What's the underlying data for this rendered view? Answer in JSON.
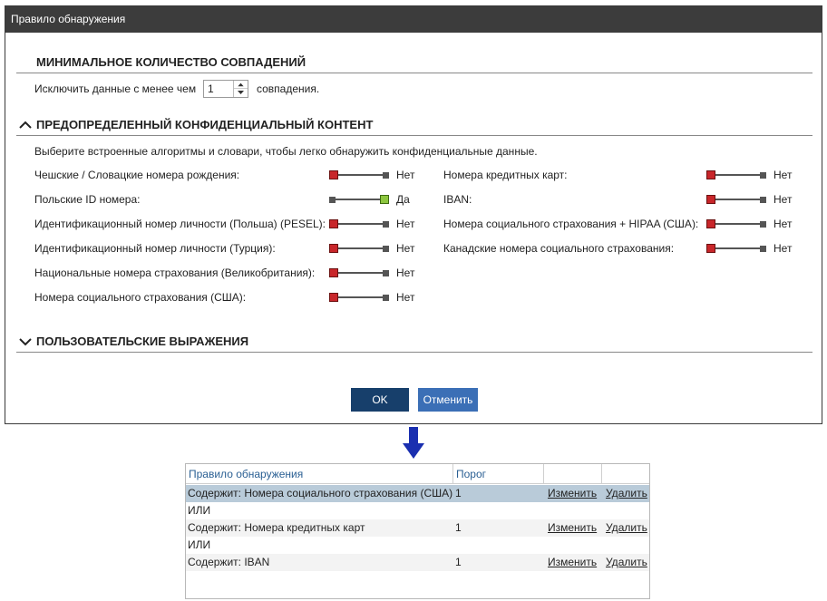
{
  "dialog": {
    "title": "Правило обнаружения",
    "min_matches": {
      "heading": "МИНИМАЛЬНОЕ КОЛИЧЕСТВО  СОВПАДЕНИЙ",
      "prefix": "Исключить данные с менее чем",
      "value": "1",
      "suffix": "совпадения."
    },
    "predefined": {
      "heading": "ПРЕДОПРЕДЕЛЕННЫЙ КОНФИДЕНЦИАЛЬНЫЙ КОНТЕНТ",
      "description": "Выберите встроенные алгоритмы и словари, чтобы легко обнаружить конфиденциальные данные.",
      "left": [
        {
          "label": "Чешские / Словацкие номера рождения:",
          "state": "Нет"
        },
        {
          "label": "Польские ID номера:",
          "state": "Да"
        },
        {
          "label": "Идентификационный номер личности (Польша) (PESEL):",
          "state": "Нет"
        },
        {
          "label": "Идентификационный номер личности (Турция):",
          "state": "Нет"
        },
        {
          "label": "Национальные номера страхования (Великобритания):",
          "state": "Нет"
        },
        {
          "label": "Номера социального страхования (США):",
          "state": "Нет"
        }
      ],
      "right": [
        {
          "label": "Номера кредитных карт:",
          "state": "Нет"
        },
        {
          "label": "IBAN:",
          "state": "Нет"
        },
        {
          "label": "Номера социального страхования + HIPAA (США):",
          "state": "Нет"
        },
        {
          "label": "Канадские номера социального страхования:",
          "state": "Нет"
        }
      ]
    },
    "custom": {
      "heading": "ПОЛЬЗОВАТЕЛЬСКИЕ ВЫРАЖЕНИЯ"
    },
    "ok_label": "OK",
    "cancel_label": "Отменить"
  },
  "colors": {
    "off": "#c8262a",
    "on": "#8dc63f",
    "ok_button": "#173f6b",
    "cancel_button": "#3b6fb6",
    "arrow": "#1a2fb0"
  },
  "table": {
    "headers": [
      "Правило обнаружения",
      "Порог",
      "",
      ""
    ],
    "rows": [
      {
        "rule": "Содержит: Номера социального страхования (США)",
        "threshold": "1",
        "edit": "Изменить",
        "delete": "Удалить"
      },
      {
        "rule": "Содержит: Номера кредитных карт",
        "threshold": "1",
        "edit": "Изменить",
        "delete": "Удалить"
      },
      {
        "rule": "Содержит: IBAN",
        "threshold": "1",
        "edit": "Изменить",
        "delete": "Удалить"
      }
    ],
    "separator": "ИЛИ"
  }
}
